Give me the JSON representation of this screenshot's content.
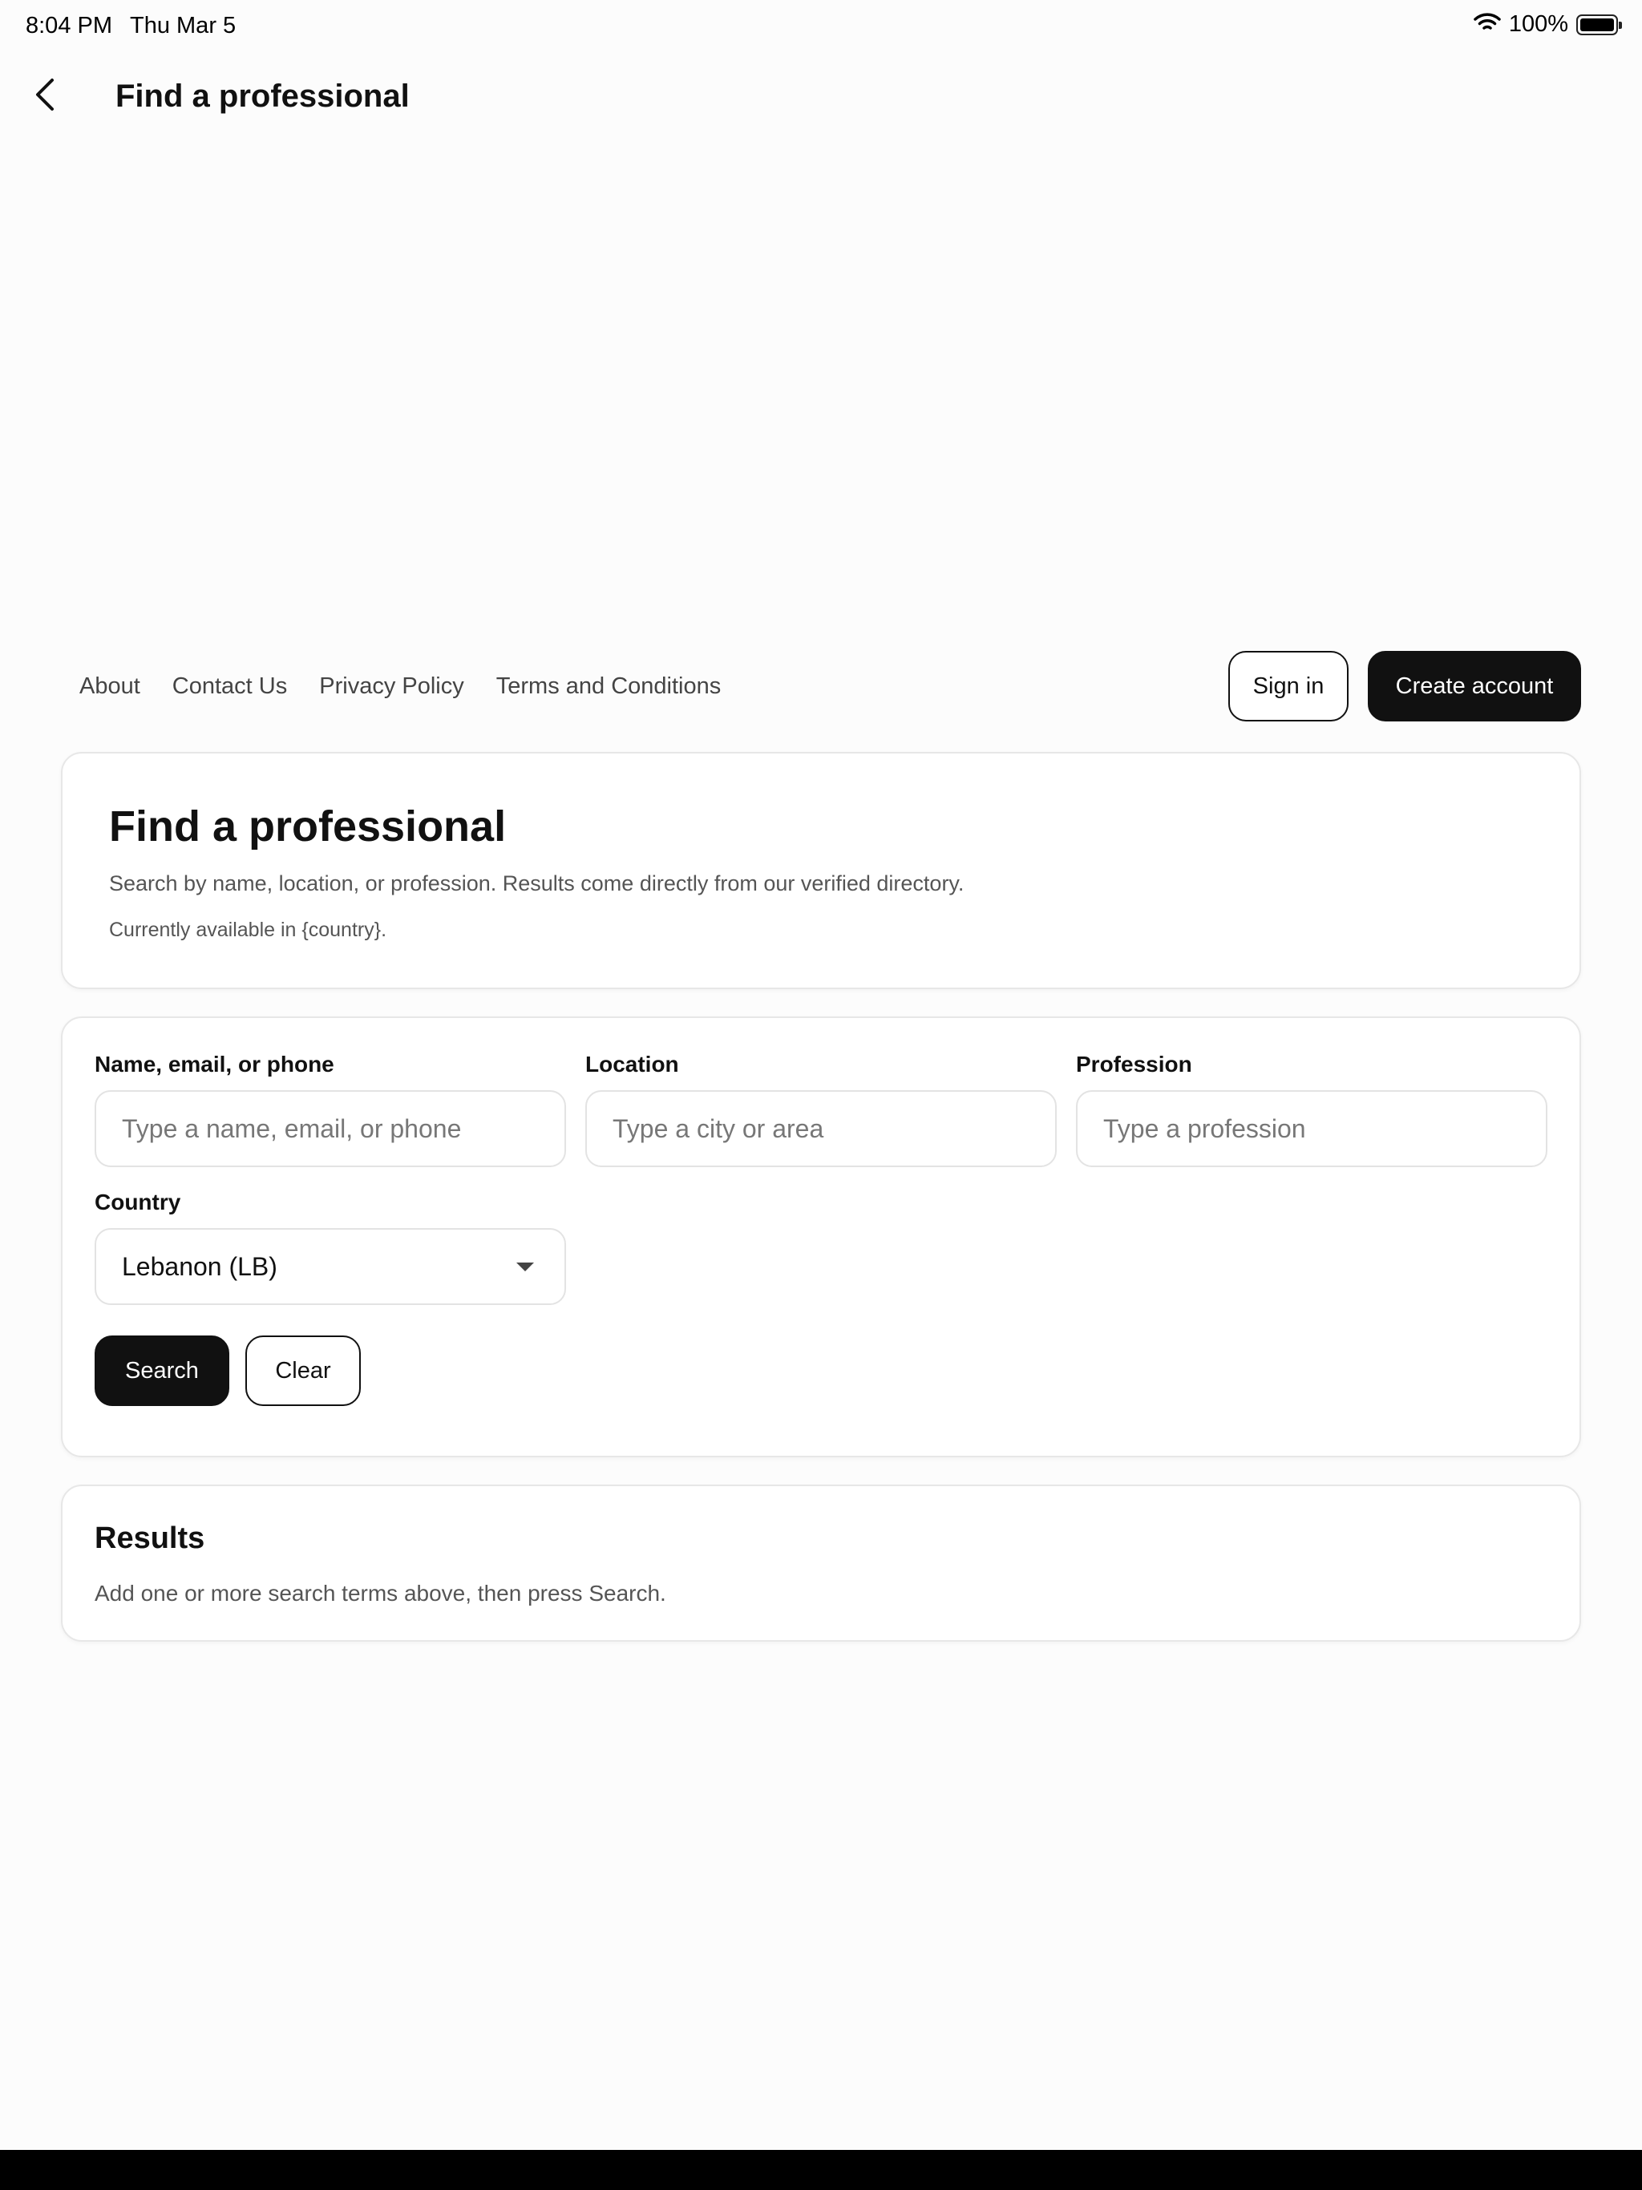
{
  "status_bar": {
    "time": "8:04 PM",
    "date": "Thu Mar 5",
    "battery_percent": "100%",
    "battery_level": 1.0,
    "icons": [
      "wifi-icon",
      "battery-icon"
    ]
  },
  "nav": {
    "back_icon": "chevron-left-icon",
    "title": "Find a professional"
  },
  "header": {
    "links": [
      "About",
      "Contact Us",
      "Privacy Policy",
      "Terms and Conditions"
    ],
    "sign_in_label": "Sign in",
    "create_account_label": "Create account"
  },
  "hero": {
    "title": "Find a professional",
    "subtitle": "Search by name, location, or profession. Results come directly from our verified directory.",
    "note": "Currently available in {country}."
  },
  "search": {
    "name_label": "Name, email, or phone",
    "name_placeholder": "Type a name, email, or phone",
    "name_value": "",
    "location_label": "Location",
    "location_placeholder": "Type a city or area",
    "location_value": "",
    "profession_label": "Profession",
    "profession_placeholder": "Type a profession",
    "profession_value": "",
    "country_label": "Country",
    "country_value": "Lebanon (LB)",
    "search_label": "Search",
    "clear_label": "Clear"
  },
  "results": {
    "title": "Results",
    "empty_message": "Add one or more search terms above, then press Search."
  },
  "colors": {
    "primary": "#111111",
    "background": "#fcfcfc",
    "card": "#ffffff",
    "border": "#e7e7e7",
    "muted_text": "#555555"
  }
}
